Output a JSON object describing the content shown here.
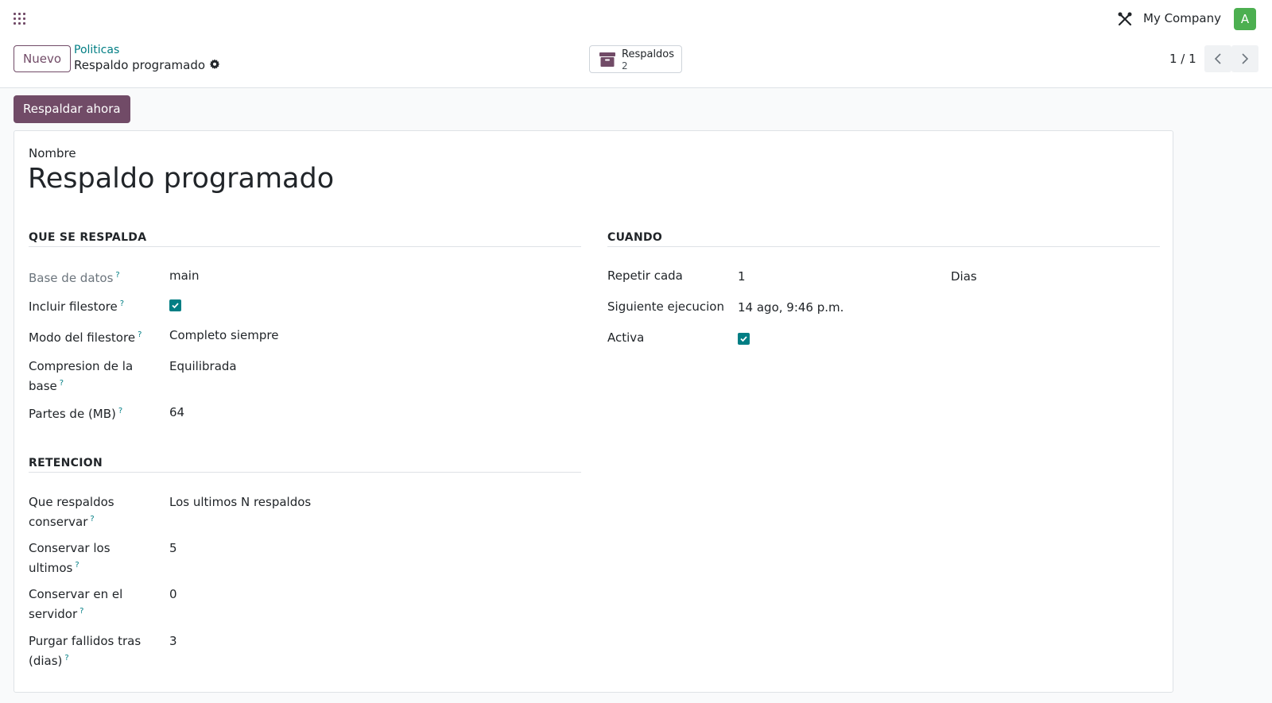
{
  "topbar": {
    "company": "My Company",
    "avatar_initial": "A"
  },
  "controlbar": {
    "new_label": "Nuevo",
    "breadcrumb_parent": "Politicas",
    "breadcrumb_current": "Respaldo programado",
    "smart_button": {
      "label": "Respaldos",
      "count": "2"
    },
    "pager": "1 / 1"
  },
  "actions": {
    "backup_now": "Respaldar ahora"
  },
  "form": {
    "name_label": "Nombre",
    "name_value": "Respaldo programado",
    "what": {
      "title": "QUE SE RESPALDA",
      "database_label": "Base de datos",
      "database_value": "main",
      "filestore_label": "Incluir filestore",
      "filestore_checked": true,
      "filestore_mode_label": "Modo del filestore",
      "filestore_mode_value": "Completo siempre",
      "compression_label_1": "Compresion de la",
      "compression_label_2": "base",
      "compression_value": "Equilibrada",
      "parts_label": "Partes de (MB)",
      "parts_value": "64"
    },
    "when": {
      "title": "CUANDO",
      "repeat_label": "Repetir cada",
      "repeat_value": "1",
      "repeat_unit": "Dias",
      "next_label": "Siguiente ejecucion",
      "next_value": "14 ago, 9:46 p.m.",
      "active_label": "Activa",
      "active_checked": true
    },
    "retention": {
      "title": "RETENCION",
      "keep_label_1": "Que respaldos",
      "keep_label_2": "conservar",
      "keep_value": "Los ultimos N respaldos",
      "last_label_1": "Conservar los",
      "last_label_2": "ultimos",
      "last_value": "5",
      "server_label_1": "Conservar en el",
      "server_label_2": "servidor",
      "server_value": "0",
      "purge_label_1": "Purgar fallidos tras",
      "purge_label_2": "(dias)",
      "purge_value": "3"
    },
    "help_marker": "?"
  },
  "colors": {
    "brand": "#714b67",
    "accent": "#017e84",
    "avatar": "#4caf50"
  }
}
